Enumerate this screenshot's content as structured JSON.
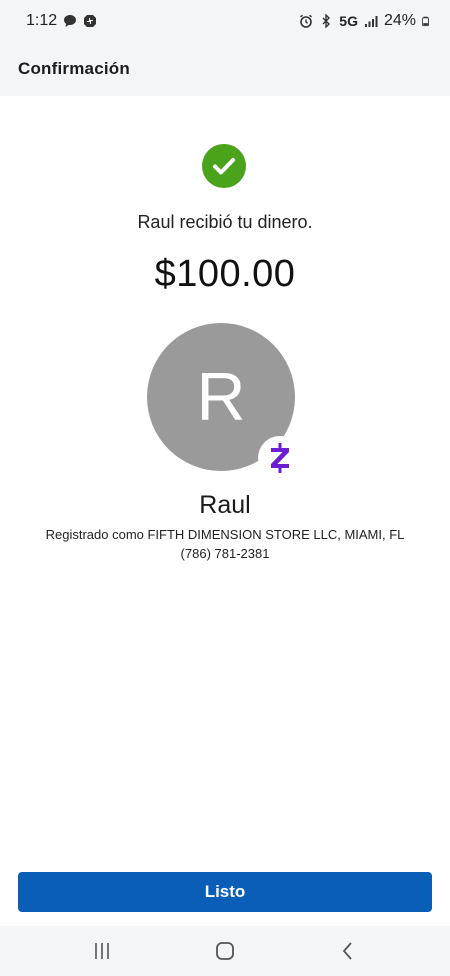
{
  "status_bar": {
    "time": "1:12",
    "network": "5G",
    "battery": "24%"
  },
  "header": {
    "title": "Confirmación"
  },
  "confirmation": {
    "message": "Raul recibió tu dinero.",
    "amount": "$100.00",
    "avatar_initial": "R",
    "recipient_name": "Raul",
    "registered_as": "Registrado como FIFTH DIMENSION STORE LLC, MIAMI, FL",
    "phone": "(786) 781-2381"
  },
  "actions": {
    "done_label": "Listo"
  },
  "colors": {
    "success_green": "#4aa31a",
    "primary_blue": "#0b5eb8",
    "zelle_purple": "#6d1ed4",
    "avatar_gray": "#9a9a9a"
  },
  "icons": [
    "chat-bubble-icon",
    "chase-logo-icon",
    "alarm-icon",
    "bluetooth-icon",
    "signal-icon",
    "battery-icon",
    "check-icon",
    "zelle-logo-icon",
    "recent-apps-icon",
    "home-icon",
    "back-icon"
  ]
}
